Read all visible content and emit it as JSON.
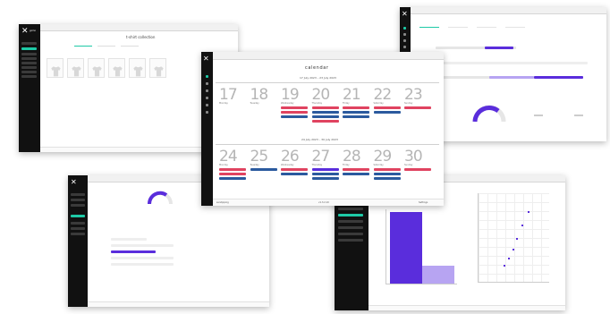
{
  "colors": {
    "accent": "#1ec9a6",
    "purple": "#5a2ddc",
    "light_purple": "#b7a4f2",
    "red": "#e04360",
    "blue": "#2b5a9e",
    "sidebar": "#111111"
  },
  "icons": [
    "logo-x-icon",
    "shirt-icon",
    "settings-icon",
    "calendar-icon",
    "user-icon",
    "gear-icon",
    "chevron-left-icon",
    "chevron-right-icon"
  ],
  "brand": "gomo",
  "catalog": {
    "title": "t-shirt collection",
    "tabs": [
      "",
      "",
      ""
    ]
  },
  "calendar": {
    "title": "calendar",
    "week1_title": "17 July 2023 – 23 July 2023",
    "week2_title": "24 July 2023 – 30 July 2023",
    "week1_days": [
      "17",
      "18",
      "19",
      "20",
      "21",
      "22",
      "23"
    ],
    "week2_days": [
      "24",
      "25",
      "26",
      "27",
      "28",
      "29",
      "30"
    ],
    "day_names": [
      "Monday",
      "Tuesday",
      "Wednesday",
      "Thursday",
      "Friday",
      "Saturday",
      "Sunday"
    ],
    "footer_left": "sandpiping",
    "footer_center": "v1.3.2.10",
    "footer_right": "Settings"
  }
}
